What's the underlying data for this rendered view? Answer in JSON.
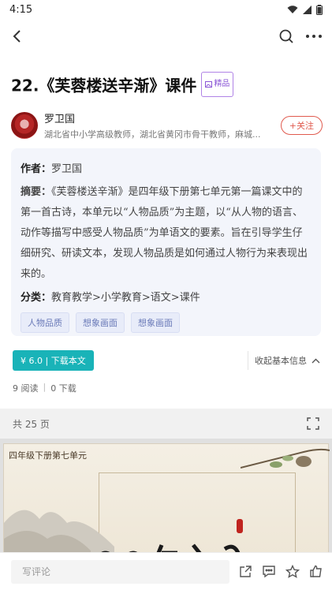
{
  "status_bar": {
    "time": "4:15"
  },
  "document": {
    "title": "22.《芙蓉楼送辛渐》课件",
    "badge_label": "精品"
  },
  "author": {
    "name": "罗卫国",
    "description": "湖北省中小学高级教师，湖北省黄冈市骨干教师，麻城...",
    "follow_label": "+关注"
  },
  "info": {
    "author_label": "作者：",
    "author_value": "罗卫国",
    "summary_label": "摘要：",
    "summary_text": "《芙蓉楼送辛渐》是四年级下册第七单元第一篇课文中的第一首古诗，本单元以“人物品质”为主题，以“从人物的语言、动作等描写中感受人物品质”为单语文的要素。旨在引导学生仔细研究、研读文本，发现人物品质是如何通过人物行为来表现出来的。",
    "category_label": "分类：",
    "category_value": "教育教学>小学教育>语文>课件",
    "tags": [
      "人物品质",
      "想象画面",
      "想象画面"
    ]
  },
  "actions": {
    "download_label": "¥ 6.0 | 下载本文",
    "collapse_label": "收起基本信息"
  },
  "stats": {
    "reads": "9 阅读",
    "downloads": "0 下载"
  },
  "preview": {
    "page_count": "共 25 页",
    "slide_label": "四年级下册第七单元"
  },
  "comment": {
    "placeholder": "写评论"
  },
  "colors": {
    "accent_teal": "#19b3b8",
    "follow_red": "#e05a4e",
    "badge_purple": "#8a55d6"
  }
}
